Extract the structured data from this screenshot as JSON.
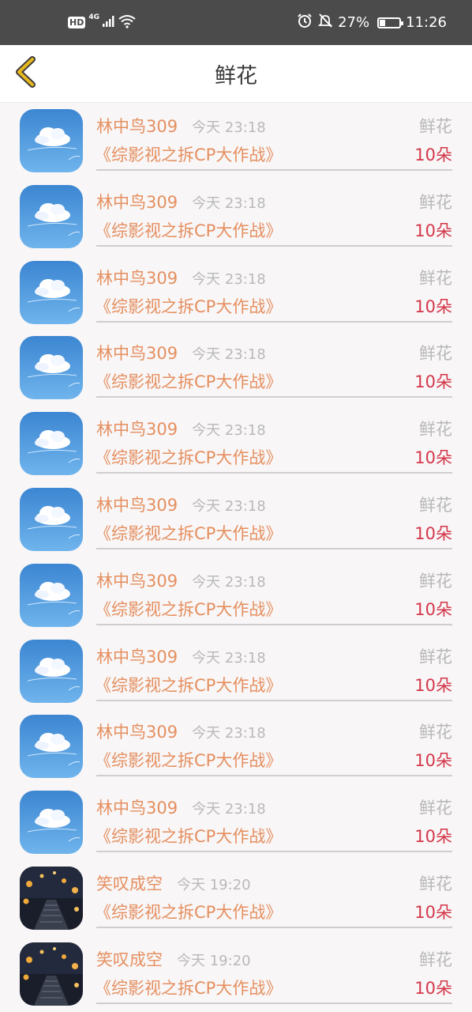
{
  "status_bar": {
    "hd": "HD",
    "network": "4G",
    "battery": "27%",
    "battery_level": 0.27,
    "time": "11:26"
  },
  "header": {
    "title": "鲜花"
  },
  "items": [
    {
      "user": "林中鸟309",
      "time": "今天 23:18",
      "gift": "鲜花",
      "book": "《综影视之拆CP大作战》",
      "count": "10朵",
      "avatar": "sky"
    },
    {
      "user": "林中鸟309",
      "time": "今天 23:18",
      "gift": "鲜花",
      "book": "《综影视之拆CP大作战》",
      "count": "10朵",
      "avatar": "sky"
    },
    {
      "user": "林中鸟309",
      "time": "今天 23:18",
      "gift": "鲜花",
      "book": "《综影视之拆CP大作战》",
      "count": "10朵",
      "avatar": "sky"
    },
    {
      "user": "林中鸟309",
      "time": "今天 23:18",
      "gift": "鲜花",
      "book": "《综影视之拆CP大作战》",
      "count": "10朵",
      "avatar": "sky"
    },
    {
      "user": "林中鸟309",
      "time": "今天 23:18",
      "gift": "鲜花",
      "book": "《综影视之拆CP大作战》",
      "count": "10朵",
      "avatar": "sky"
    },
    {
      "user": "林中鸟309",
      "time": "今天 23:18",
      "gift": "鲜花",
      "book": "《综影视之拆CP大作战》",
      "count": "10朵",
      "avatar": "sky"
    },
    {
      "user": "林中鸟309",
      "time": "今天 23:18",
      "gift": "鲜花",
      "book": "《综影视之拆CP大作战》",
      "count": "10朵",
      "avatar": "sky"
    },
    {
      "user": "林中鸟309",
      "time": "今天 23:18",
      "gift": "鲜花",
      "book": "《综影视之拆CP大作战》",
      "count": "10朵",
      "avatar": "sky"
    },
    {
      "user": "林中鸟309",
      "time": "今天 23:18",
      "gift": "鲜花",
      "book": "《综影视之拆CP大作战》",
      "count": "10朵",
      "avatar": "sky"
    },
    {
      "user": "林中鸟309",
      "time": "今天 23:18",
      "gift": "鲜花",
      "book": "《综影视之拆CP大作战》",
      "count": "10朵",
      "avatar": "sky"
    },
    {
      "user": "笑叹成空",
      "time": "今天 19:20",
      "gift": "鲜花",
      "book": "《综影视之拆CP大作战》",
      "count": "10朵",
      "avatar": "lanterns"
    },
    {
      "user": "笑叹成空",
      "time": "今天 19:20",
      "gift": "鲜花",
      "book": "《综影视之拆CP大作战》",
      "count": "10朵",
      "avatar": "lanterns"
    }
  ],
  "colors": {
    "name": "#e58f5f",
    "count": "#d4374a",
    "muted": "#b8b8b8",
    "back_arrow": "#e8b820"
  }
}
